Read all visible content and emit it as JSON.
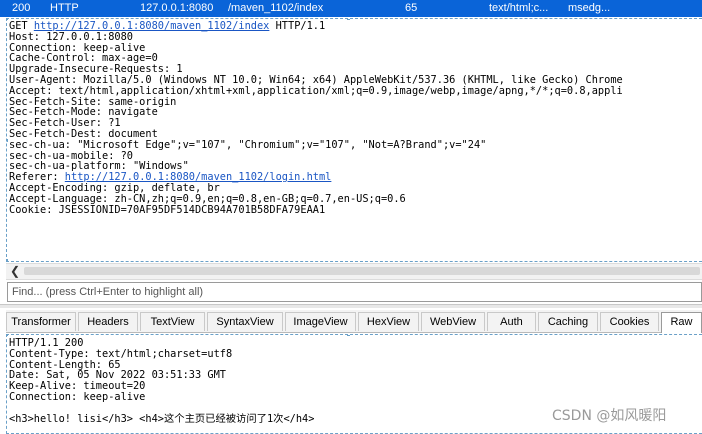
{
  "session_row": {
    "result": "200",
    "protocol": "HTTP",
    "host": "127.0.0.1:8080",
    "url": "/maven_1102/index",
    "body": "65",
    "content_type": "text/html;c...",
    "process": "msedg..."
  },
  "request": {
    "method": "GET",
    "url": "http://127.0.0.1:8080/maven_1102/index",
    "version": "HTTP/1.1",
    "headers": [
      "Host: 127.0.0.1:8080",
      "Connection: keep-alive",
      "Cache-Control: max-age=0",
      "Upgrade-Insecure-Requests: 1",
      "User-Agent: Mozilla/5.0 (Windows NT 10.0; Win64; x64) AppleWebKit/537.36 (KHTML, like Gecko) Chrome",
      "Accept: text/html,application/xhtml+xml,application/xml;q=0.9,image/webp,image/apng,*/*;q=0.8,appli",
      "Sec-Fetch-Site: same-origin",
      "Sec-Fetch-Mode: navigate",
      "Sec-Fetch-User: ?1",
      "Sec-Fetch-Dest: document",
      "sec-ch-ua: \"Microsoft Edge\";v=\"107\", \"Chromium\";v=\"107\", \"Not=A?Brand\";v=\"24\"",
      "sec-ch-ua-mobile: ?0",
      "sec-ch-ua-platform: \"Windows\""
    ],
    "referer_label": "Referer: ",
    "referer_url": "http://127.0.0.1:8080/maven_1102/login.html",
    "headers_after": [
      "Accept-Encoding: gzip, deflate, br",
      "Accept-Language: zh-CN,zh;q=0.9,en;q=0.8,en-GB;q=0.7,en-US;q=0.6",
      "Cookie: JSESSIONID=70AF95DF514DCB94A701B58DFA79EAA1"
    ]
  },
  "find": {
    "placeholder": "Find... (press Ctrl+Enter to highlight all)"
  },
  "tabs": [
    "Transformer",
    "Headers",
    "TextView",
    "SyntaxView",
    "ImageView",
    "HexView",
    "WebView",
    "Auth",
    "Caching",
    "Cookies",
    "Raw"
  ],
  "active_tab": "Raw",
  "response": {
    "lines": [
      "HTTP/1.1 200",
      "Content-Type: text/html;charset=utf8",
      "Content-Length: 65",
      "Date: Sat, 05 Nov 2022 03:51:33 GMT",
      "Keep-Alive: timeout=20",
      "Connection: keep-alive",
      "",
      "<h3>hello! lisi</h3> <h4>这个主页已经被访问了1次</h4>"
    ]
  },
  "watermark": "CSDN @如风暖阳",
  "icons": {
    "scroll_left": "chevron-left-icon"
  },
  "colors": {
    "selected_row": "#0a64d8",
    "link": "#1a56c4"
  }
}
